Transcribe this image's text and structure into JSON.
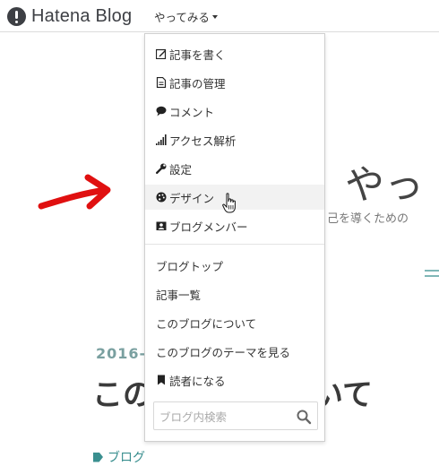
{
  "header": {
    "logo_text": "Hatena Blog",
    "try_menu_label": "やってみる"
  },
  "menu": {
    "items": [
      {
        "label": "記事を書く",
        "icon": "edit-icon"
      },
      {
        "label": "記事の管理",
        "icon": "document-icon"
      },
      {
        "label": "コメント",
        "icon": "comment-icon"
      },
      {
        "label": "アクセス解析",
        "icon": "signal-bars-icon"
      },
      {
        "label": "設定",
        "icon": "wrench-icon"
      },
      {
        "label": "デザイン",
        "icon": "palette-icon"
      },
      {
        "label": "ブログメンバー",
        "icon": "member-card-icon"
      }
    ],
    "blog_links": [
      {
        "label": "ブログトップ"
      },
      {
        "label": "記事一覧"
      },
      {
        "label": "このブログについて"
      },
      {
        "label": "このブログのテーマを見る"
      },
      {
        "label": "読者になる",
        "icon": "bookmark-icon"
      }
    ],
    "hovered_item": "デザイン",
    "search": {
      "placeholder": "ブログ内検索",
      "value": ""
    }
  },
  "blog": {
    "title_visible": "やっ",
    "description_visible": "く己を導くための",
    "post_date_visible": "2016-",
    "post_title_visible": "この",
    "post_title_suffix_visible": "いて",
    "tag": "ブログ"
  },
  "colors": {
    "accent_teal": "#3a8f8f",
    "annotation_red": "#e01010",
    "hover_bg": "#f2f2f2"
  }
}
